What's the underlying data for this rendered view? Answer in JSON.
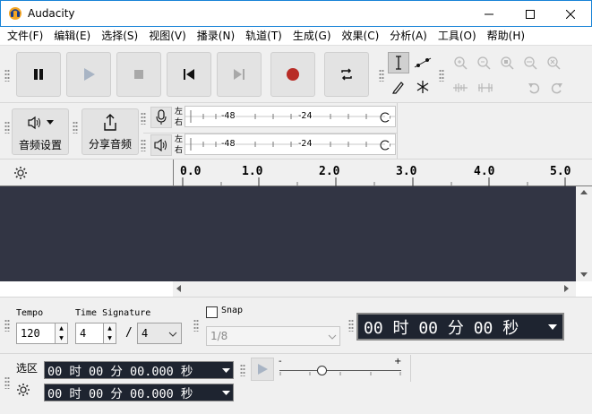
{
  "window": {
    "title": "Audacity"
  },
  "menu": [
    "文件(F)",
    "编辑(E)",
    "选择(S)",
    "视图(V)",
    "播录(N)",
    "轨道(T)",
    "生成(G)",
    "效果(C)",
    "分析(A)",
    "工具(O)",
    "帮助(H)"
  ],
  "toolbar": {
    "audio_setup": "音频设置",
    "share_audio": "分享音频"
  },
  "meters": {
    "record": {
      "left": "左",
      "right": "右",
      "val1": "-48",
      "val2": "-24"
    },
    "play": {
      "left": "左",
      "right": "右",
      "val1": "-48",
      "val2": "-24"
    }
  },
  "ruler": {
    "ticks": [
      "0.0",
      "1.0",
      "2.0",
      "3.0",
      "4.0",
      "5.0"
    ]
  },
  "bottom": {
    "tempo_label": "Tempo",
    "tempo_value": "120",
    "timesig_label": "Time Signature",
    "timesig_num": "4",
    "timesig_slash": "/",
    "timesig_den": "4",
    "snap_label": "Snap",
    "snap_value": "1/8",
    "time_display": "00 时 00 分 00 秒",
    "selection_label": "选区",
    "sel_start": "00 时 00 分 00.000 秒",
    "sel_end": "00 时 00 分 00.000 秒",
    "speed_min": "-",
    "speed_max": "+"
  },
  "colors": {
    "accent": "#1883d7",
    "track_bg": "#323544",
    "record_red": "#b82c26",
    "toolbar_bg": "#f0f0f0"
  },
  "playback_speed": {
    "fraction": 0.35
  }
}
